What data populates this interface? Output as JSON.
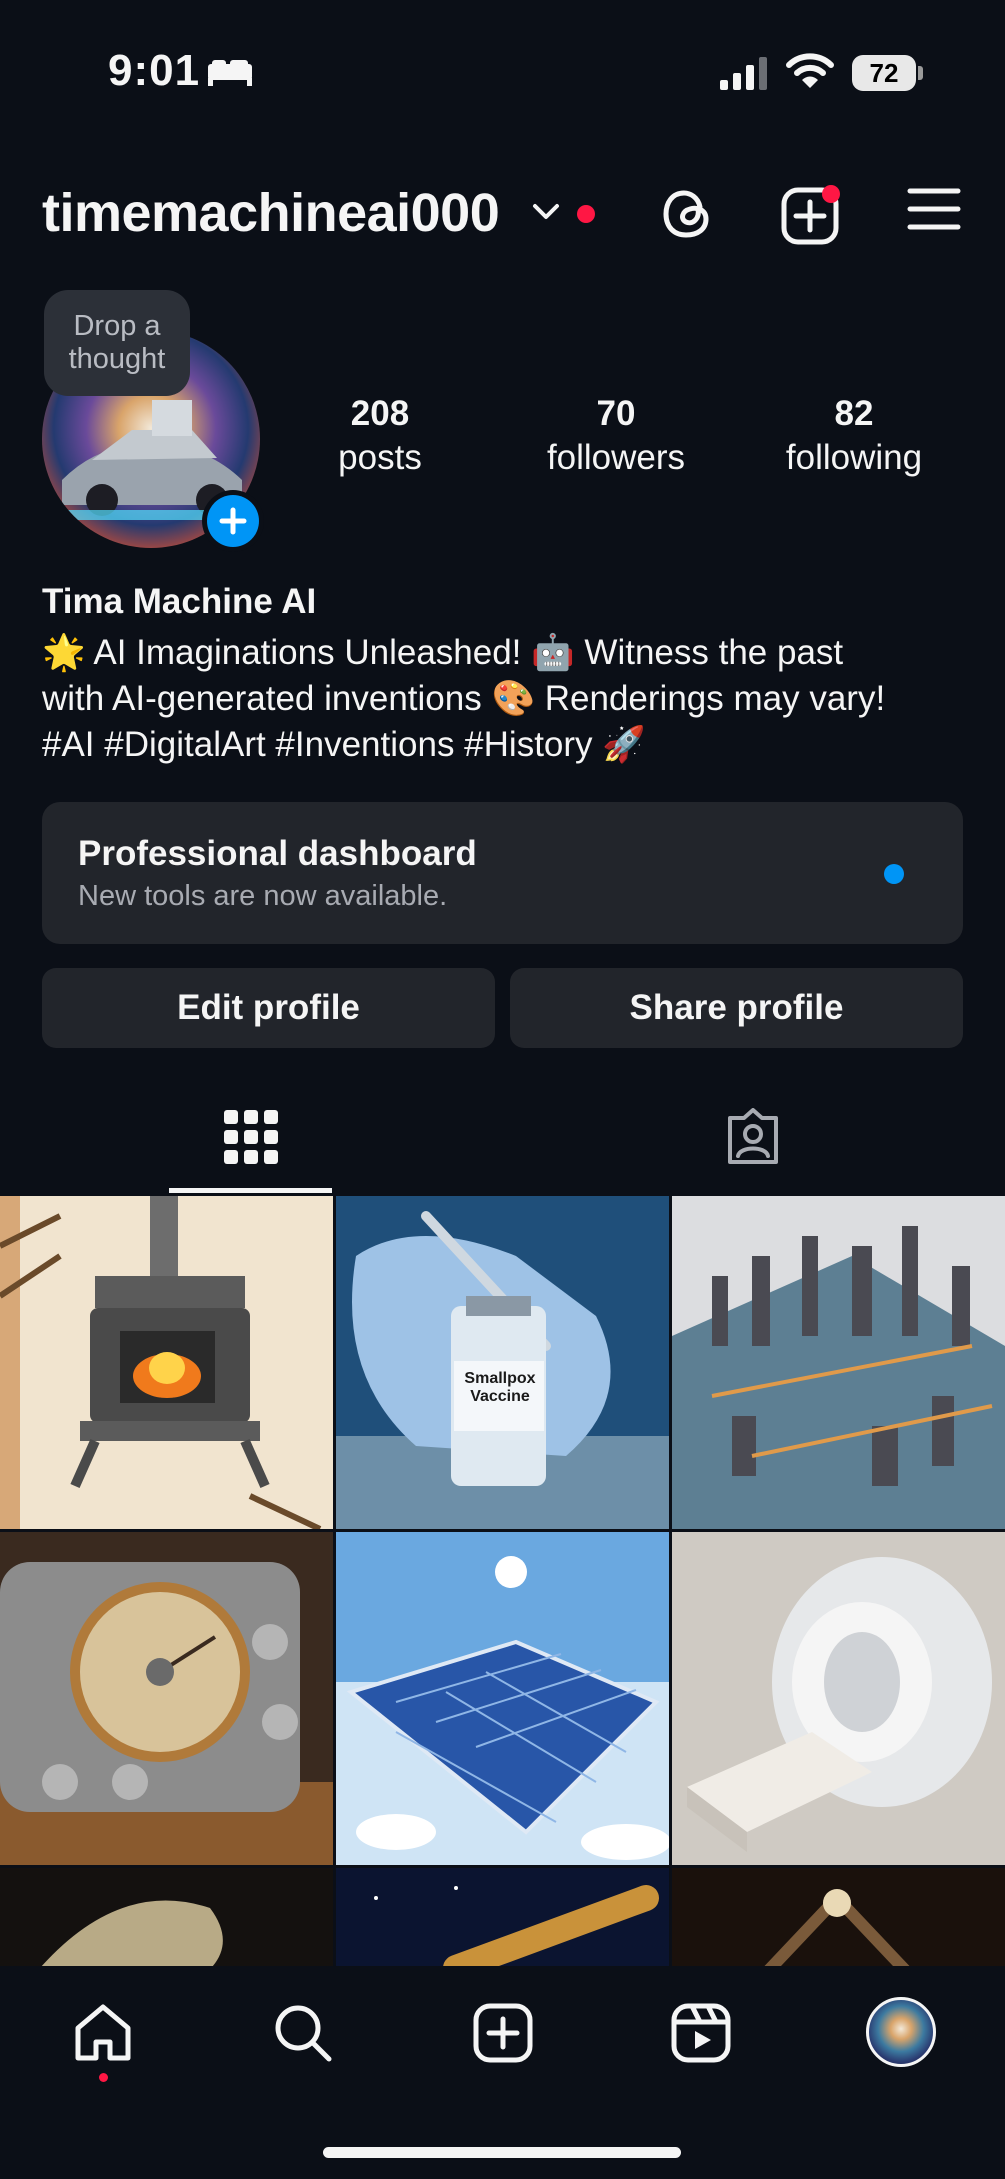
{
  "status_bar": {
    "time": "9:01",
    "battery": "72"
  },
  "header": {
    "username": "timemachineai000"
  },
  "profile": {
    "thought_bubble": "Drop a thought",
    "stats": [
      {
        "num": "208",
        "label": "posts"
      },
      {
        "num": "70",
        "label": "followers"
      },
      {
        "num": "82",
        "label": "following"
      }
    ],
    "name": "Tima Machine AI",
    "bio_lines": [
      "🌟 AI Imaginations Unleashed! 🤖 Witness the past",
      "with AI-generated inventions 🎨 Renderings may vary!",
      "#AI #DigitalArt #Inventions #History 🚀"
    ]
  },
  "dashboard": {
    "title": "Professional dashboard",
    "subtitle": "New tools are now available."
  },
  "buttons": {
    "edit": "Edit profile",
    "share": "Share profile"
  },
  "grid": {
    "vaccine_label_1": "Smallpox",
    "vaccine_label_2": "Vaccine"
  },
  "colors": {
    "background": "#0b0f17",
    "card": "#22252b",
    "accent_blue": "#0095f6",
    "notification_red": "#ff1744"
  },
  "icons": {
    "status": [
      "bed-icon",
      "signal-icon",
      "wifi-icon",
      "battery-icon"
    ],
    "header": [
      "threads-icon",
      "create-icon",
      "menu-icon"
    ],
    "tabs": [
      "grid-icon",
      "tagged-icon"
    ],
    "nav": [
      "home-icon",
      "search-icon",
      "create-icon",
      "reels-icon",
      "profile-avatar"
    ]
  }
}
